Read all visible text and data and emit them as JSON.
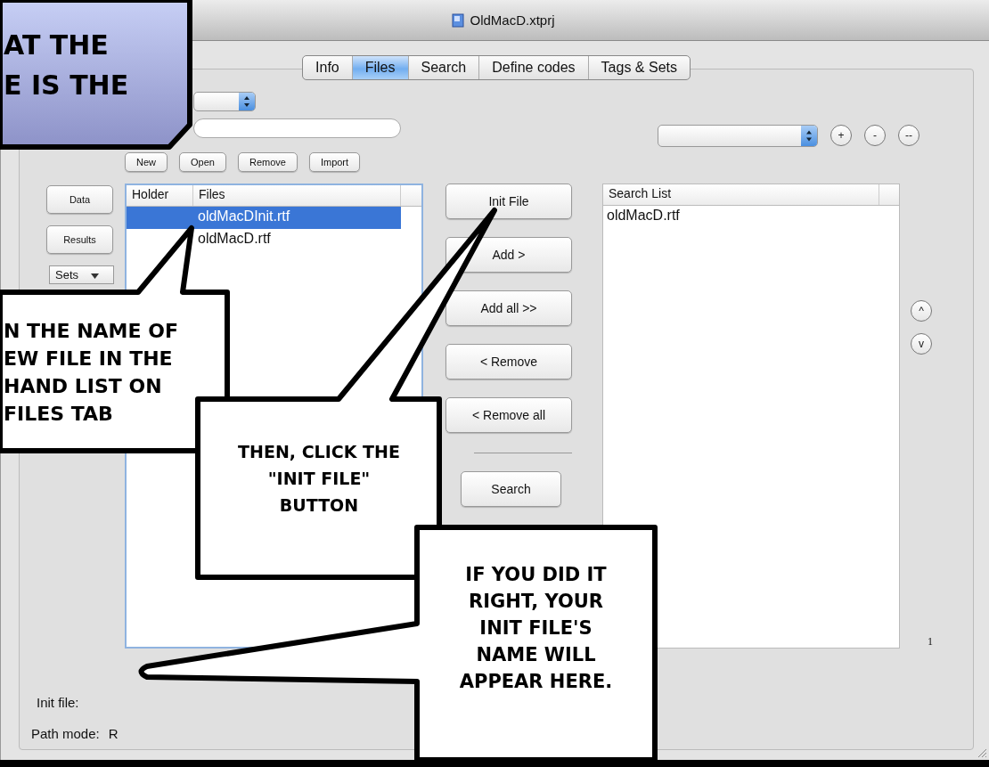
{
  "window": {
    "title": "OldMacD.xtprj"
  },
  "tabs": [
    {
      "label": "Info",
      "selected": false
    },
    {
      "label": "Files",
      "selected": true
    },
    {
      "label": "Search",
      "selected": false
    },
    {
      "label": "Define codes",
      "selected": false
    },
    {
      "label": "Tags & Sets",
      "selected": false
    }
  ],
  "file_buttons": [
    "New",
    "Open",
    "Remove",
    "Import"
  ],
  "side_buttons": [
    "Data",
    "Results"
  ],
  "sets_menu": {
    "label": "Sets"
  },
  "files_table": {
    "columns": [
      "Holder",
      "Files"
    ],
    "rows": [
      {
        "file": "oldMacDInit.rtf",
        "selected": true
      },
      {
        "file": "oldMacD.rtf",
        "selected": false
      }
    ]
  },
  "transfer_buttons": [
    "Init File",
    "Add >",
    "Add all >>",
    "< Remove",
    "< Remove all"
  ],
  "search_button": "Search",
  "set_buttons": [
    "+",
    "-",
    "--"
  ],
  "move_buttons": [
    "^",
    "v"
  ],
  "search_list": {
    "column": "Search List",
    "rows": [
      "oldMacD.rtf"
    ]
  },
  "list_count": "1",
  "footer": {
    "init_file_label": "Init file:",
    "path_mode_label": "Path mode:",
    "path_mode_value": "R"
  },
  "callouts": [
    {
      "kind": "caption",
      "text": "AT THE\nE IS THE"
    },
    {
      "kind": "speech",
      "text": "N THE NAME OF\nEW FILE IN THE\nHAND LIST ON\nFILES TAB"
    },
    {
      "kind": "speech",
      "text": "THEN, CLICK THE\n\"INIT FILE\"\nBUTTON"
    },
    {
      "kind": "speech",
      "text": "IF YOU DID IT\nRIGHT, YOUR\nINIT FILE'S\nNAME WILL\nAPPEAR HERE."
    }
  ]
}
